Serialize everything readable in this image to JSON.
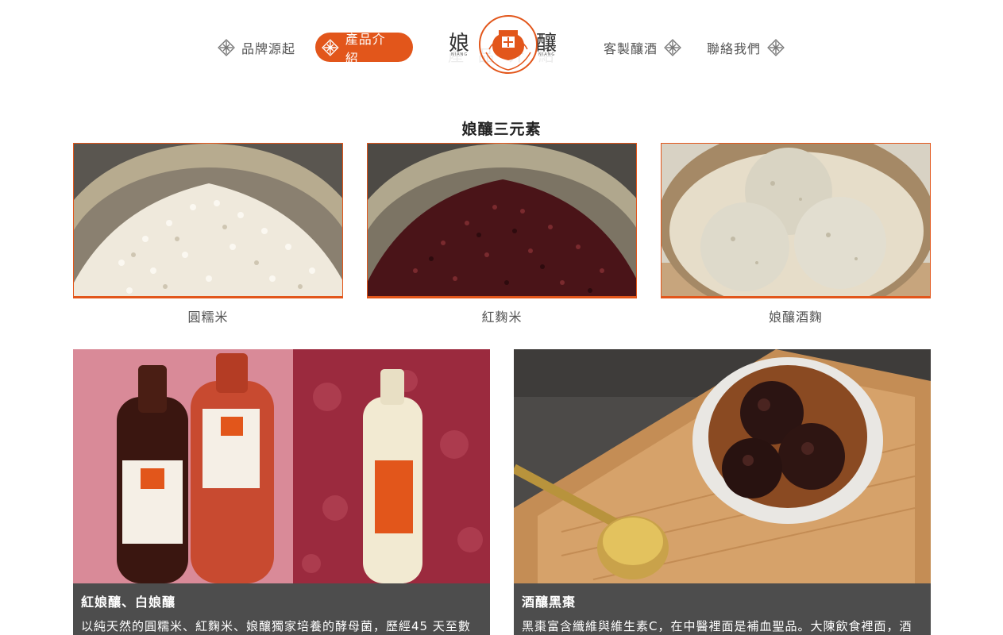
{
  "nav": {
    "items": [
      {
        "label": "品牌源起"
      },
      {
        "label": "產品介紹",
        "active": true
      },
      {
        "label": "客製釀酒"
      },
      {
        "label": "聯絡我們"
      }
    ],
    "accent_color": "#e2561b"
  },
  "logo": {
    "left_char": "娘",
    "right_char": "釀",
    "left_sub": "NIANG",
    "right_sub": "NIANG",
    "ghost_text": "產品介紹"
  },
  "section": {
    "title": "娘釀三元素"
  },
  "ingredients": [
    {
      "caption": "圓糯米"
    },
    {
      "caption": "紅麴米"
    },
    {
      "caption": "娘釀酒麴"
    }
  ],
  "products": [
    {
      "title": "紅娘釀、白娘釀",
      "desc": "以純天然的圓糯米、紅麴米、娘釀獨家培養的酵母菌，歷經45 天至數"
    },
    {
      "title": "酒釀黑棗",
      "desc": "黑棗富含纖維與維生素C，在中醫裡面是補血聖品。大陳飲食裡面，酒"
    }
  ]
}
